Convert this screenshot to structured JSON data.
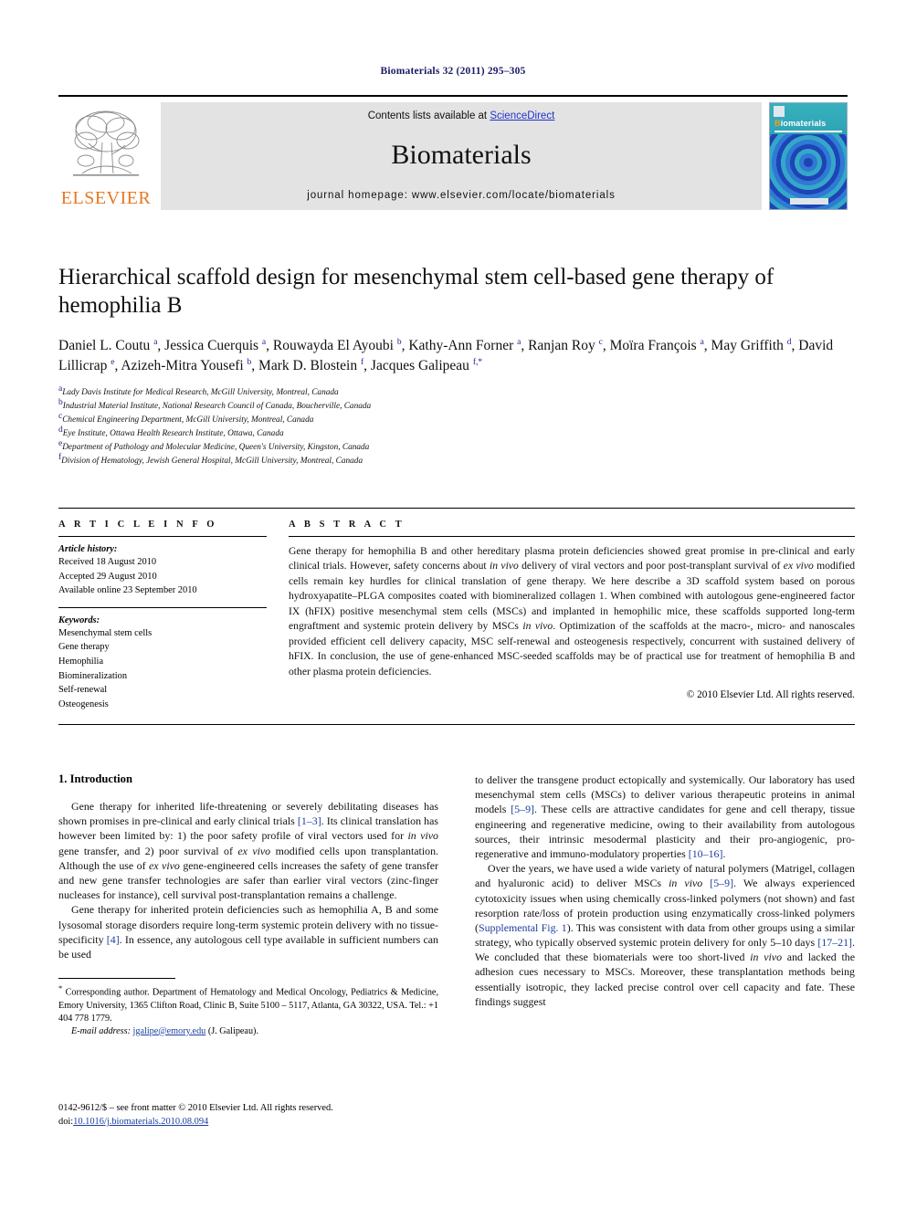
{
  "running_head": "Biomaterials 32 (2011) 295–305",
  "masthead": {
    "publisher": "ELSEVIER",
    "contents_prefix": "Contents lists available at ",
    "contents_link": "ScienceDirect",
    "journal_name": "Biomaterials",
    "homepage": "journal homepage: www.elsevier.com/locate/biomaterials",
    "cover_title_first": "B",
    "cover_title_rest": "iomaterials",
    "colors": {
      "elsevier_orange": "#E87722",
      "link_blue": "#2233cc",
      "running_head_navy": "#1a1a66",
      "cover_teal": "#2ca8b8"
    }
  },
  "article": {
    "title": "Hierarchical scaffold design for mesenchymal stem cell-based gene therapy of hemophilia B",
    "authors_html": "Daniel L. Coutu <sup>a</sup>, Jessica Cuerquis <sup>a</sup>, Rouwayda El Ayoubi <sup>b</sup>, Kathy-Ann Forner <sup>a</sup>, Ranjan Roy <sup>c</sup>, Moïra François <sup>a</sup>, May Griffith <sup>d</sup>, David Lillicrap <sup>e</sup>, Azizeh-Mitra Yousefi <sup>b</sup>, Mark D. Blostein <sup>f</sup>, Jacques Galipeau <sup>f,</sup><sup>*</sup>",
    "affiliations": [
      {
        "label": "a",
        "text": "Lady Davis Institute for Medical Research, McGill University, Montreal, Canada"
      },
      {
        "label": "b",
        "text": "Industrial Material Institute, National Research Council of Canada, Boucherville, Canada"
      },
      {
        "label": "c",
        "text": "Chemical Engineering Department, McGill University, Montreal, Canada"
      },
      {
        "label": "d",
        "text": "Eye Institute, Ottawa Health Research Institute, Ottawa, Canada"
      },
      {
        "label": "e",
        "text": "Department of Pathology and Molecular Medicine, Queen's University, Kingston, Canada"
      },
      {
        "label": "f",
        "text": "Division of Hematology, Jewish General Hospital, McGill University, Montreal, Canada"
      }
    ]
  },
  "article_info": {
    "heading": "A R T I C L E   I N F O",
    "history_label": "Article history:",
    "history": [
      "Received 18 August 2010",
      "Accepted 29 August 2010",
      "Available online 23 September 2010"
    ],
    "keywords_label": "Keywords:",
    "keywords": [
      "Mesenchymal stem cells",
      "Gene therapy",
      "Hemophilia",
      "Biomineralization",
      "Self-renewal",
      "Osteogenesis"
    ]
  },
  "abstract": {
    "heading": "A B S T R A C T",
    "text_html": "Gene therapy for hemophilia B and other hereditary plasma protein deficiencies showed great promise in pre-clinical and early clinical trials. However, safety concerns about <span class=\"it\">in vivo</span> delivery of viral vectors and poor post-transplant survival of <span class=\"it\">ex vivo</span> modified cells remain key hurdles for clinical translation of gene therapy. We here describe a 3D scaffold system based on porous hydroxyapatite&#8211;PLGA composites coated with biomineralized collagen 1. When combined with autologous gene-engineered factor IX (hFIX) positive mesenchymal stem cells (MSCs) and implanted in hemophilic mice, these scaffolds supported long-term engraftment and systemic protein delivery by MSCs <span class=\"it\">in vivo</span>. Optimization of the scaffolds at the macro-, micro- and nanoscales provided efficient cell delivery capacity, MSC self-renewal and osteogenesis respectively, concurrent with sustained delivery of hFIX. In conclusion, the use of gene-enhanced MSC-seeded scaffolds may be of practical use for treatment of hemophilia B and other plasma protein deficiencies.",
    "copyright": "© 2010 Elsevier Ltd. All rights reserved."
  },
  "introduction": {
    "heading": "1.  Introduction",
    "left_paragraphs_html": [
      "Gene therapy for inherited life-threatening or severely debilitating diseases has shown promises in pre-clinical and early clinical trials <span class=\"ref\">[1&#8211;3]</span>. Its clinical translation has however been limited by: 1) the poor safety profile of viral vectors used for <span class=\"it\">in vivo</span> gene transfer, and 2) poor survival of <span class=\"it\">ex vivo</span> modified cells upon transplantation. Although the use of <span class=\"it\">ex vivo</span> gene-engineered cells increases the safety of gene transfer and new gene transfer technologies are safer than earlier viral vectors (zinc-finger nucleases for instance), cell survival post-transplantation remains a challenge.",
      "Gene therapy for inherited protein deficiencies such as hemophilia A, B and some lysosomal storage disorders require long-term systemic protein delivery with no tissue-specificity <span class=\"ref\">[4]</span>. In essence, any autologous cell type available in sufficient numbers can be used"
    ],
    "right_paragraphs_html": [
      "to deliver the transgene product ectopically and systemically. Our laboratory has used mesenchymal stem cells (MSCs) to deliver various therapeutic proteins in animal models <span class=\"ref\">[5&#8211;9]</span>. These cells are attractive candidates for gene and cell therapy, tissue engineering and regenerative medicine, owing to their availability from autologous sources, their intrinsic mesodermal plasticity and their pro-angiogenic, pro-regenerative and immuno-modulatory properties <span class=\"ref\">[10&#8211;16]</span>.",
      "Over the years, we have used a wide variety of natural polymers (Matrigel, collagen and hyaluronic acid) to deliver MSCs <span class=\"it\">in vivo</span> <span class=\"ref\">[5&#8211;9]</span>. We always experienced cytotoxicity issues when using chemically cross-linked polymers (not shown) and fast resorption rate/loss of protein production using enzymatically cross-linked polymers (<span class=\"ref\">Supplemental Fig. 1</span>). This was consistent with data from other groups using a similar strategy, who typically observed systemic protein delivery for only 5&#8211;10 days <span class=\"ref\">[17&#8211;21]</span>. We concluded that these biomaterials were too short-lived <span class=\"it\">in vivo</span> and lacked the adhesion cues necessary to MSCs. Moreover, these transplantation methods being essentially isotropic, they lacked precise control over cell capacity and fate. These findings suggest"
    ]
  },
  "footnote": {
    "text_html": "<sup>*</sup> Corresponding author. Department of Hematology and Medical Oncology, Pediatrics &amp; Medicine, Emory University, 1365 Clifton Road, Clinic B, Suite 5100 &#8211; 5117, Atlanta, GA 30322, USA. Tel.: +1 404 778 1779.",
    "email_label": "E-mail address:",
    "email": "jgalipe@emory.edu",
    "email_suffix": "(J. Galipeau)."
  },
  "imprint": {
    "line1": "0142-9612/$ – see front matter © 2010 Elsevier Ltd. All rights reserved.",
    "doi_label": "doi:",
    "doi": "10.1016/j.biomaterials.2010.08.094"
  }
}
